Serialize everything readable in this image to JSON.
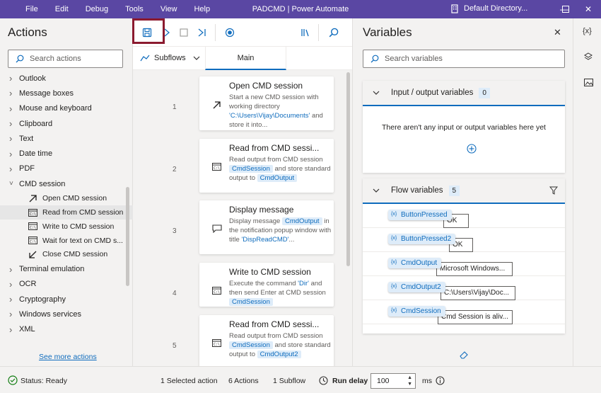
{
  "titlebar": {
    "menu": [
      "File",
      "Edit",
      "Debug",
      "Tools",
      "View",
      "Help"
    ],
    "title": "PADCMD | Power Automate",
    "account": "Default Directory..."
  },
  "actions": {
    "title": "Actions",
    "search_placeholder": "Search actions",
    "tree": [
      {
        "label": "Outlook",
        "expanded": false
      },
      {
        "label": "Message boxes",
        "expanded": false
      },
      {
        "label": "Mouse and keyboard",
        "expanded": false
      },
      {
        "label": "Clipboard",
        "expanded": false
      },
      {
        "label": "Text",
        "expanded": false
      },
      {
        "label": "Date time",
        "expanded": false
      },
      {
        "label": "PDF",
        "expanded": false
      },
      {
        "label": "CMD session",
        "expanded": true
      }
    ],
    "cmd_children": [
      {
        "label": "Open CMD session",
        "icon": "arrow-up-right-icon"
      },
      {
        "label": "Read from CMD session",
        "icon": "cmd-icon",
        "selected": true
      },
      {
        "label": "Write to CMD session",
        "icon": "cmd-icon"
      },
      {
        "label": "Wait for text on CMD s...",
        "icon": "cmd-icon"
      },
      {
        "label": "Close CMD session",
        "icon": "arrow-down-left-icon"
      }
    ],
    "tree_after": [
      {
        "label": "Terminal emulation"
      },
      {
        "label": "OCR"
      },
      {
        "label": "Cryptography"
      },
      {
        "label": "Windows services"
      },
      {
        "label": "XML"
      }
    ],
    "see_more": "See more actions"
  },
  "canvas": {
    "subflows_label": "Subflows",
    "main_tab": "Main",
    "steps": [
      {
        "num": "1",
        "title": "Open CMD session",
        "desc": [
          "Start a new CMD session with working directory ",
          {
            "q": "'C:\\Users\\Vijay\\Documents'"
          },
          " and store it into..."
        ]
      },
      {
        "num": "2",
        "title": "Read from CMD sessi...",
        "desc": [
          "Read output from CMD session ",
          {
            "c": "CmdSession"
          },
          " and store standard output to ",
          {
            "c": "CmdOutput"
          }
        ]
      },
      {
        "num": "3",
        "title": "Display message",
        "desc": [
          "Display message ",
          {
            "c": "CmdOutput"
          },
          " in the notification popup window with title ",
          {
            "q": "'DispReadCMD'"
          },
          "..."
        ]
      },
      {
        "num": "4",
        "title": "Write to CMD session",
        "desc": [
          "Execute the command ",
          {
            "q": "'Dir'"
          },
          " and then send Enter at CMD session ",
          {
            "c": "CmdSession"
          }
        ]
      },
      {
        "num": "5",
        "title": "Read from CMD sessi...",
        "desc": [
          "Read output from CMD session ",
          {
            "c": "CmdSession"
          },
          " and store standard output to ",
          {
            "c": "CmdOutput2"
          }
        ]
      }
    ]
  },
  "variables": {
    "title": "Variables",
    "search_placeholder": "Search variables",
    "io": {
      "label": "Input / output variables",
      "count": "0",
      "empty": "There aren't any input or output variables here yet"
    },
    "flow": {
      "label": "Flow variables",
      "count": "5",
      "items": [
        {
          "name": "ButtonPressed",
          "value": "OK"
        },
        {
          "name": "ButtonPressed2",
          "value": "OK"
        },
        {
          "name": "CmdOutput",
          "value": "Microsoft Windows..."
        },
        {
          "name": "CmdOutput2",
          "value": "C:\\Users\\Vijay\\Doc..."
        },
        {
          "name": "CmdSession",
          "value": "Cmd Session is aliv..."
        }
      ]
    }
  },
  "status": {
    "state": "Status: Ready",
    "selected": "1 Selected action",
    "actions": "6 Actions",
    "subflow": "1 Subflow",
    "run_delay_label": "Run delay",
    "run_delay_value": "100",
    "unit": "ms"
  },
  "colors": {
    "titlebar": "#5a47a3",
    "accent": "#0f6cbd",
    "highlight": "#8b1a2f"
  }
}
